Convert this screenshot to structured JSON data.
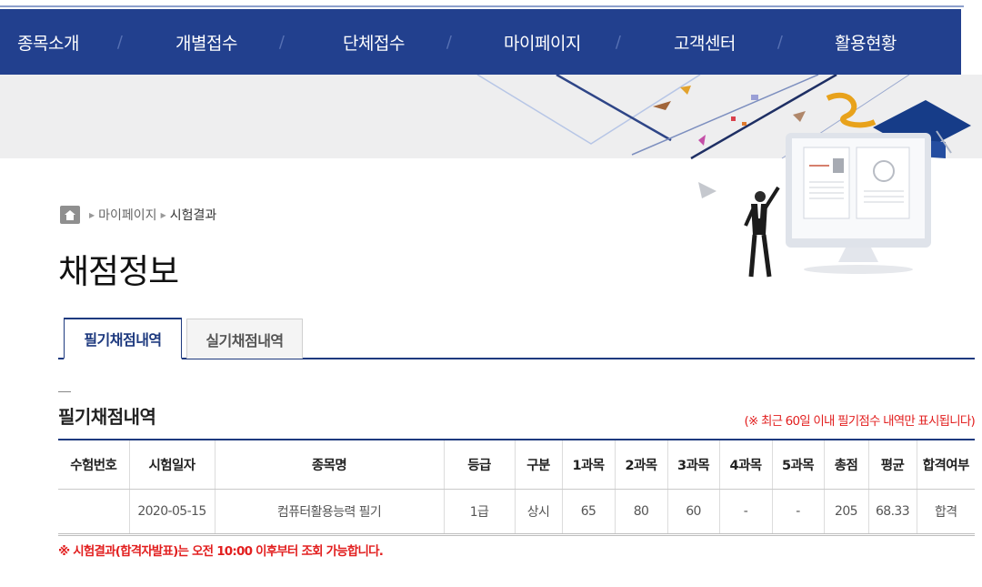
{
  "nav": {
    "items": [
      "종목소개",
      "개별접수",
      "단체접수",
      "마이페이지",
      "고객센터",
      "활용현황"
    ],
    "separator": "/"
  },
  "breadcrumb": {
    "home_icon": "home-icon",
    "items": [
      "마이페이지",
      "시험결과"
    ],
    "separator": "▶"
  },
  "page": {
    "title": "채점정보"
  },
  "tabs": [
    {
      "label": "필기채점내역",
      "active": true
    },
    {
      "label": "실기채점내역",
      "active": false
    }
  ],
  "section": {
    "title": "필기채점내역",
    "notice": "(※ 최근 60일 이내 필기점수 내역만 표시됩니다)"
  },
  "table": {
    "headers": [
      "수험번호",
      "시험일자",
      "종목명",
      "등급",
      "구분",
      "1과목",
      "2과목",
      "3과목",
      "4과목",
      "5과목",
      "총점",
      "평균",
      "합격여부"
    ],
    "rows": [
      [
        "",
        "2020-05-15",
        "컴퓨터활용능력 필기",
        "1급",
        "상시",
        "65",
        "80",
        "60",
        "-",
        "-",
        "205",
        "68.33",
        "합격"
      ]
    ]
  },
  "footnote": "※ 시험결과(합격자발표)는 오전 10:00 이후부터 조회 가능합니다.",
  "colors": {
    "nav_bg": "#22408e",
    "accent": "#1e3a7f",
    "alert": "#e21f1f"
  }
}
